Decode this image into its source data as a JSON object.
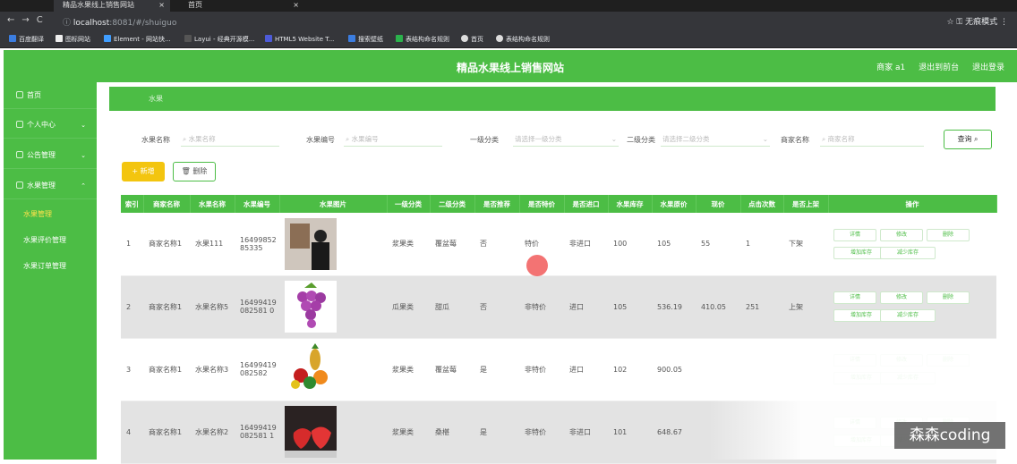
{
  "browser": {
    "tabs": [
      {
        "label": "精品水果线上销售网站"
      },
      {
        "label": "首页"
      }
    ],
    "url_host": "localhost",
    "url_path": ":8081/#/shuiguo",
    "profile": "无痕模式",
    "bookmarks": [
      "百度翻译",
      "图标网站",
      "Element - 网站快...",
      "Layui - 经典开源模...",
      "HTML5 Website T...",
      "搜索壁纸",
      "表结构命名规则",
      "首页",
      "表结构命名规则"
    ]
  },
  "header": {
    "title": "精品水果线上销售网站",
    "user": "商家 a1",
    "back": "退出到前台",
    "logout": "退出登录"
  },
  "sidebar": {
    "items": [
      {
        "label": "首页"
      },
      {
        "label": "个人中心"
      },
      {
        "label": "公告管理"
      },
      {
        "label": "水果管理"
      }
    ],
    "subitems": [
      {
        "label": "水果管理"
      },
      {
        "label": "水果评价管理"
      },
      {
        "label": "水果订单管理"
      }
    ]
  },
  "breadcrumb": "水果",
  "search": {
    "name_label": "水果名称",
    "name_placeholder": "水果名称",
    "code_label": "水果编号",
    "code_placeholder": "水果编号",
    "cat1_label": "一级分类",
    "cat1_placeholder": "请选择一级分类",
    "cat2_label": "二级分类",
    "cat2_placeholder": "请选择二级分类",
    "shop_label": "商家名称",
    "shop_placeholder": "商家名称",
    "query_button": "查询"
  },
  "toolbar": {
    "add": "新增",
    "delete": "删除"
  },
  "table": {
    "headers": [
      "索引",
      "商家名称",
      "水果名称",
      "水果编号",
      "水果图片",
      "一级分类",
      "二级分类",
      "是否推荐",
      "是否特价",
      "是否进口",
      "水果库存",
      "水果原价",
      "现价",
      "点击次数",
      "是否上架",
      "操作"
    ],
    "rows": [
      {
        "index": "1",
        "shop": "商家名称1",
        "name": "水果111",
        "code": "1649985285335",
        "image": "person-photo",
        "cat1": "浆果类",
        "cat2": "覆盆莓",
        "recommend": "否",
        "special": "特价",
        "imported": "非进口",
        "stock": "100",
        "orig": "105",
        "price": "55",
        "clicks": "1",
        "onsale": "下架"
      },
      {
        "index": "2",
        "shop": "商家名称1",
        "name": "水果名称5",
        "code": "16499419082581 0",
        "image": "grapes",
        "cat1": "瓜果类",
        "cat2": "甜瓜",
        "recommend": "否",
        "special": "非特价",
        "imported": "进口",
        "stock": "105",
        "orig": "536.19",
        "price": "410.05",
        "clicks": "251",
        "onsale": "上架"
      },
      {
        "index": "3",
        "shop": "商家名称1",
        "name": "水果名称3",
        "code": "16499419082582",
        "image": "fruit-mix",
        "cat1": "浆果类",
        "cat2": "覆盆莓",
        "recommend": "是",
        "special": "非特价",
        "imported": "进口",
        "stock": "102",
        "orig": "900.05",
        "price": "",
        "clicks": "",
        "onsale": ""
      },
      {
        "index": "4",
        "shop": "商家名称1",
        "name": "水果名称2",
        "code": "16499419082581 1",
        "image": "strawberries",
        "cat1": "浆果类",
        "cat2": "桑椹",
        "recommend": "是",
        "special": "非特价",
        "imported": "非进口",
        "stock": "101",
        "orig": "648.67",
        "price": "",
        "clicks": "",
        "onsale": ""
      }
    ],
    "actions": {
      "detail": "详情",
      "edit": "修改",
      "delete": "删除",
      "add_stock": "增加库存",
      "reduce_stock": "减少库存"
    }
  },
  "watermark": "森森coding",
  "colors": {
    "primary": "#4cbd45",
    "warning": "#f3c50f"
  }
}
